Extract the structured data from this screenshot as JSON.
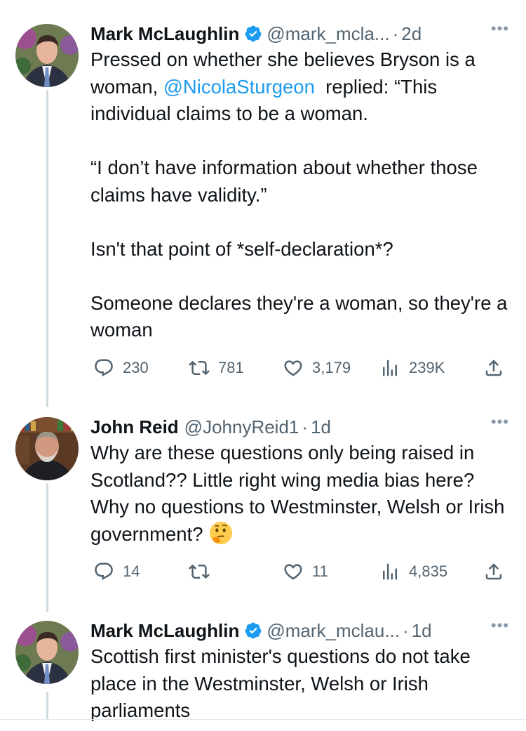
{
  "tweets": [
    {
      "name": "Mark McLaughlin",
      "handle": "@mark_mcla...",
      "time": "2d",
      "text_before": "Pressed on whether she believes Bryson is a woman, ",
      "mention": "@NicolaSturgeon",
      "text_after": "  replied: “This individual claims to be a woman.\n\n“I don’t have information about whether those claims have validity.”\n\nIsn't that point of *self-declaration*?\n\nSomeone declares they're a woman, so they're a woman",
      "replies": "230",
      "retweets": "781",
      "likes": "3,179",
      "views": "239K"
    },
    {
      "name": "John Reid",
      "handle": "@JohnyReid1",
      "time": "1d",
      "text": "Why are these questions only being raised in Scotland?? Little right wing media bias here?  Why no questions to Westminster, Welsh or Irish government?",
      "emoji": "thinking-face",
      "replies": "14",
      "retweets": "",
      "likes": "11",
      "views": "4,835"
    },
    {
      "name": "Mark McLaughlin",
      "handle": "@mark_mclau...",
      "time": "1d",
      "text": "Scottish first minister's questions do not take place in the Westminster, Welsh or Irish parliaments"
    }
  ],
  "ui": {
    "separator": "·",
    "more": "•••"
  },
  "colors": {
    "accent": "#1d9bf0",
    "muted": "#536471",
    "thread_line": "#cfd9de"
  }
}
